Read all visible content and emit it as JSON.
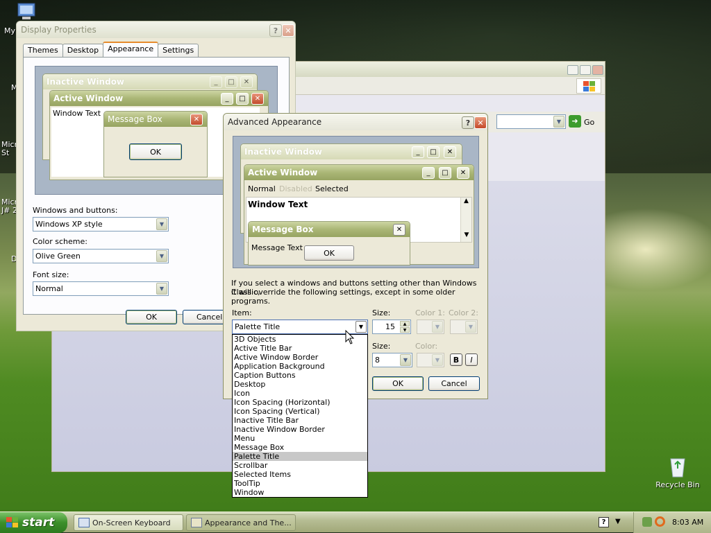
{
  "desktop": {
    "icons": [
      {
        "label": "My"
      },
      {
        "label": "M"
      },
      {
        "label": "Micro St"
      },
      {
        "label": "Micro J# 2"
      },
      {
        "label": "D"
      }
    ],
    "recycle_bin": "Recycle Bin"
  },
  "bg_window": {
    "go_label": "Go"
  },
  "display_properties": {
    "title": "Display Properties",
    "tabs": [
      "Themes",
      "Desktop",
      "Appearance",
      "Settings"
    ],
    "selected_tab": "Appearance",
    "preview": {
      "inactive_title": "Inactive Window",
      "active_title": "Active Window",
      "window_text": "Window Text",
      "msgbox_title": "Message Box",
      "ok": "OK"
    },
    "windows_buttons_label": "Windows and buttons:",
    "windows_buttons_value": "Windows XP style",
    "color_scheme_label": "Color scheme:",
    "color_scheme_value": "Olive Green",
    "font_size_label": "Font size:",
    "font_size_value": "Normal",
    "ok": "OK",
    "cancel": "Cancel"
  },
  "advanced": {
    "title": "Advanced Appearance",
    "preview": {
      "inactive_title": "Inactive Window",
      "active_title": "Active Window",
      "menu_normal": "Normal",
      "menu_disabled": "Disabled",
      "menu_selected": "Selected",
      "window_text": "Window Text",
      "msgbox_title": "Message Box",
      "msgbox_text": "Message Text",
      "ok": "OK"
    },
    "info_line1": "If you select a windows and buttons setting other than Windows Classic,",
    "info_line2": "it will override the following settings, except in some older programs.",
    "item_label": "Item:",
    "item_value": "Palette Title",
    "size_label": "Size:",
    "size_value": "15",
    "color1_label": "Color 1:",
    "color2_label": "Color 2:",
    "font_size_label": "Size:",
    "font_size_value": "8",
    "font_color_label": "Color:",
    "bold": "B",
    "italic": "I",
    "ok": "OK",
    "cancel": "Cancel",
    "item_options": [
      "3D Objects",
      "Active Title Bar",
      "Active Window Border",
      "Application Background",
      "Caption Buttons",
      "Desktop",
      "Icon",
      "Icon Spacing (Horizontal)",
      "Icon Spacing (Vertical)",
      "Inactive Title Bar",
      "Inactive Window Border",
      "Menu",
      "Message Box",
      "Palette Title",
      "Scrollbar",
      "Selected Items",
      "ToolTip",
      "Window"
    ],
    "highlighted_option": "Palette Title"
  },
  "taskbar": {
    "start": "start",
    "items": [
      "On-Screen Keyboard",
      "Appearance and The..."
    ],
    "clock": "8:03 AM"
  }
}
